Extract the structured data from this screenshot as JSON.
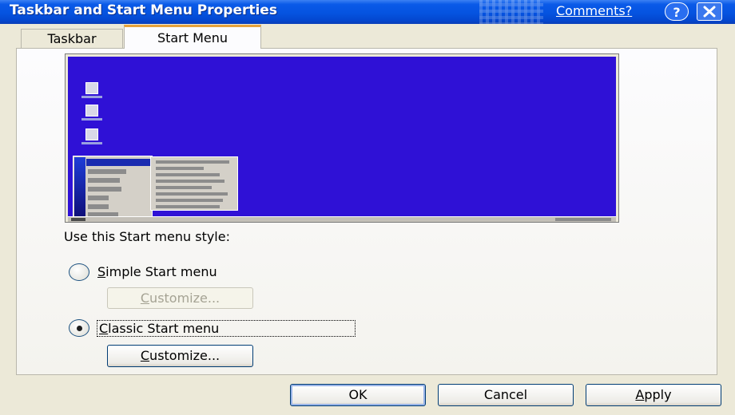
{
  "window": {
    "title": "Taskbar and Start Menu Properties",
    "comments_link": "Comments?",
    "help_glyph": "?"
  },
  "tabs": [
    {
      "label": "Taskbar",
      "selected": false
    },
    {
      "label": "Start Menu",
      "selected": true
    }
  ],
  "style_group": {
    "label": "Use this Start menu style:",
    "options": [
      {
        "label_accel": "S",
        "label_rest": "imple Start menu",
        "selected": false,
        "customize": {
          "accel": "C",
          "rest": "ustomize...",
          "enabled": false
        }
      },
      {
        "label_accel": "C",
        "label_rest": "lassic Start menu",
        "selected": true,
        "customize": {
          "accel": "C",
          "rest": "ustomize...",
          "enabled": true
        }
      }
    ]
  },
  "buttons": {
    "ok": "OK",
    "cancel": "Cancel",
    "apply_accel": "A",
    "apply_rest": "pply"
  },
  "colors": {
    "title_bar": "#0553e0",
    "dialog_bg": "#ece9d8",
    "preview_desktop": "#2f11d6",
    "selected_tab_accent": "#e6a23a"
  },
  "icons": {
    "close": "close-icon",
    "help": "help-icon"
  }
}
